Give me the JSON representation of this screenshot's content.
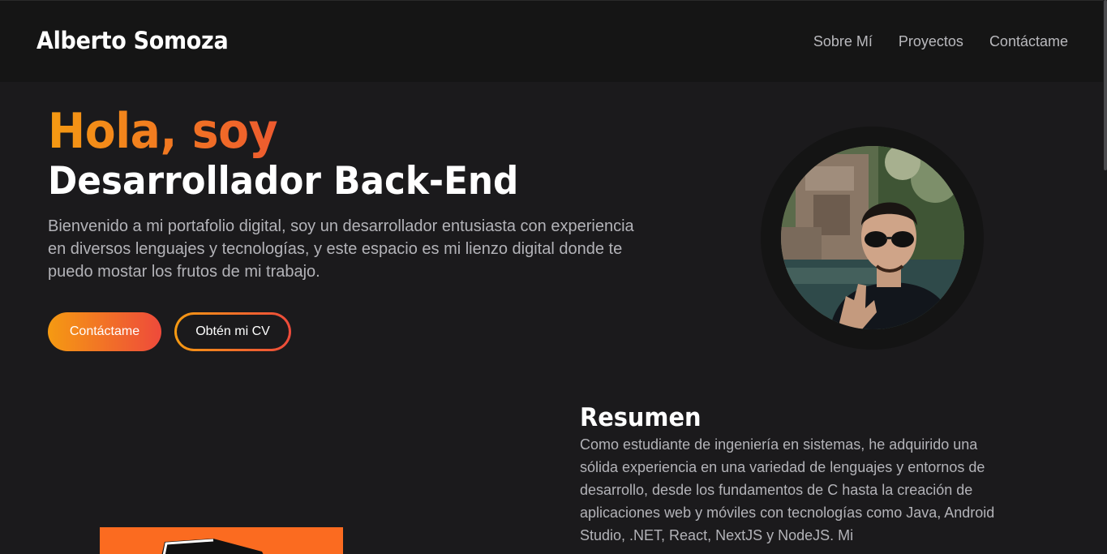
{
  "header": {
    "brand": "Alberto Somoza",
    "nav": [
      {
        "label": "Sobre Mí"
      },
      {
        "label": "Proyectos"
      },
      {
        "label": "Contáctame"
      }
    ]
  },
  "hero": {
    "greeting": "Hola, soy",
    "role": "Desarrollador Back-End",
    "description": "Bienvenido a mi portafolio digital, soy un desarrollador entusiasta con experiencia en diversos lenguajes y tecnologías, y este espacio es mi lienzo digital donde te puedo mostar los frutos de mi trabajo.",
    "buttons": {
      "contact": "Contáctame",
      "cv": "Obtén mi CV"
    }
  },
  "summary": {
    "title": "Resumen",
    "text": "Como estudiante de ingeniería en sistemas, he adquirido una sólida experiencia en una variedad de lenguajes y entornos de desarrollo, desde los fundamentos de C hasta la creación de aplicaciones web y móviles con tecnologías como Java, Android Studio, .NET, React, NextJS y NodeJS. Mi"
  },
  "colors": {
    "accent_start": "#f59a12",
    "accent_end": "#ee4a3b",
    "background": "#1b1a1c",
    "header_bg": "#151515"
  }
}
